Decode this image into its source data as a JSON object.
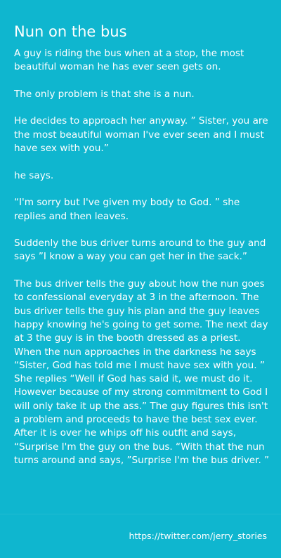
{
  "post": {
    "title": "Nun on the bus",
    "paragraphs": [
      "A guy is riding the bus when at a stop, the most beautiful woman he has ever seen gets on.",
      "The only problem is that she is a nun.",
      "He decides to approach her anyway. ” Sister, you are the most beautiful woman I've ever seen and I must have sex with you.”",
      "he says.",
      "“I'm sorry but I've given my body to God. ” she replies and then leaves.",
      "Suddenly the bus driver turns around to the guy and says ”I know a way you can get her in the sack.”",
      "The bus driver tells the guy about how the nun goes to confessional everyday at 3 in the afternoon. The bus driver tells the guy his plan and the guy leaves happy knowing he's going to get some. The next day at 3 the guy is in the booth dressed as a priest. When the nun approaches in the darkness he says “Sister, God has told me I must have sex with you. ” She replies “Well if God has said it, we must do it. However because of my strong commitment to God I will only take it up the ass.” The guy figures this isn't a problem and proceeds to have the best sex ever. After it is over he whips off his outfit and says, “Surprise I'm the guy on the bus. “With that the nun turns around and says, ”Surprise I'm the bus driver. ”"
    ]
  },
  "footer": {
    "link": "https://twitter.com/jerry_stories"
  },
  "colors": {
    "background": "#0fb6cf",
    "text": "#ffffff"
  }
}
